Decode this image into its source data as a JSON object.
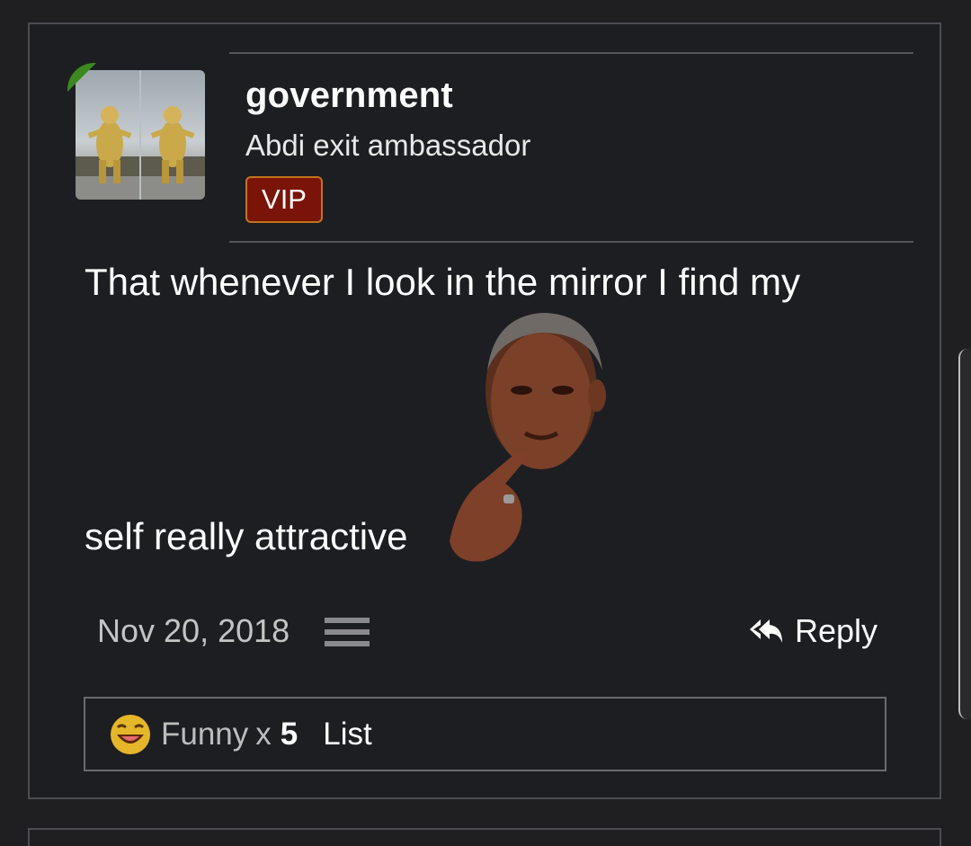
{
  "post": {
    "author": {
      "username": "government",
      "title": "Abdi exit ambassador",
      "badge": "VIP",
      "avatar": "polar-bears-image",
      "online": true
    },
    "body": {
      "line1": "That whenever I look in the mirror I find my",
      "line2": "self really attractive",
      "inline_image": "thinking-man-sticker"
    },
    "date": "Nov 20, 2018",
    "actions": {
      "reply_label": "Reply"
    },
    "reactions": {
      "name": "Funny",
      "x": "x",
      "count": "5",
      "list_label": "List"
    }
  },
  "colors": {
    "background": "#1d1e22",
    "border": "#4c4c52",
    "badge_bg": "#7a1408",
    "badge_border": "#c1741c",
    "online_badge": "#3c8a1f"
  }
}
